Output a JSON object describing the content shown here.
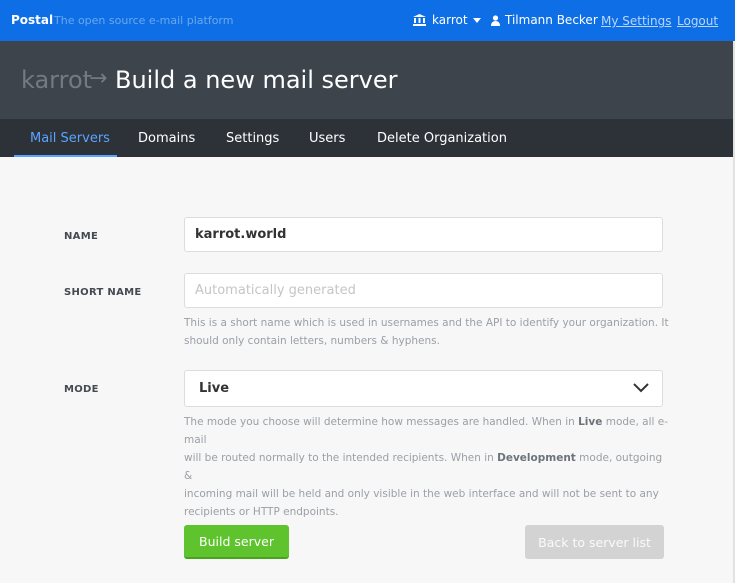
{
  "topbar": {
    "brand": "Postal",
    "tagline": "The open source e-mail platform",
    "organization": "karrot",
    "user_name": "Tilmann Becker",
    "my_settings": "My Settings",
    "logout": "Logout"
  },
  "header": {
    "org": "karrot",
    "arrow": "→",
    "title": "Build a new mail server"
  },
  "nav": {
    "items": [
      {
        "label": "Mail Servers",
        "active": true
      },
      {
        "label": "Domains"
      },
      {
        "label": "Settings"
      },
      {
        "label": "Users"
      },
      {
        "label": "Delete Organization"
      }
    ]
  },
  "form": {
    "name_label": "NAME",
    "name_value": "karrot.world",
    "short_label": "SHORT NAME",
    "short_placeholder": "Automatically generated",
    "short_help_1": "This is a short name which is used in usernames and the API to identify your organization. It",
    "short_help_2": "should only contain letters, numbers & hyphens.",
    "mode_label": "MODE",
    "mode_value": "Live",
    "mode_help": {
      "a": "The mode you choose will determine how messages are handled. When in ",
      "b": "Live",
      "c": " mode, all e-mail",
      "d": "will be routed normally to the intended recipients. When in ",
      "e": "Development",
      "f": " mode, outgoing &",
      "g": "incoming mail will be held and only visible in the web interface and will not be sent to any",
      "h": "recipients or HTTP endpoints."
    },
    "build_button": "Build server",
    "back_button": "Back to server list"
  },
  "colors": {
    "topbar": "#0d6ee6",
    "header": "#3e444c",
    "nav": "#2d3239",
    "nav_active": "#5aa4ff",
    "build": "#5ec32c",
    "back": "#d3d3d3"
  }
}
